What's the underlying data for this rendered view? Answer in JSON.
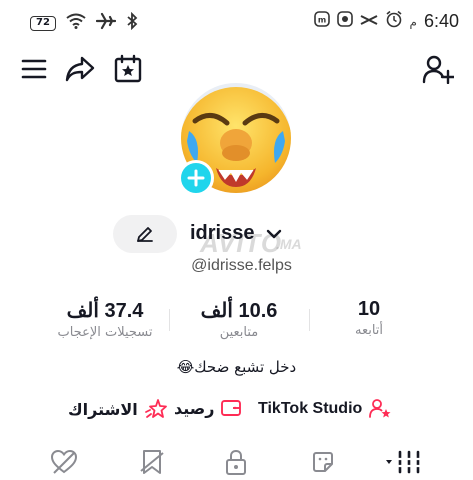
{
  "status": {
    "battery": "72",
    "time": "6:40",
    "ampm": "م"
  },
  "colors": {
    "accent": "#20d5ec",
    "pink": "#fe2c55",
    "text": "#161823",
    "muted": "#8a8b91"
  },
  "profile": {
    "username": "idrisse",
    "handle": "@idrisse.felps",
    "bio": "دخل تشبع ضحك😂",
    "watermark": "AVITO",
    "watermark_suffix": ".MA"
  },
  "stats": {
    "following": {
      "value": "10",
      "label": "أتابعه"
    },
    "followers": {
      "value": "10.6 ألف",
      "label": "متابعين"
    },
    "likes": {
      "value": "37.4 ألف",
      "label": "تسجيلات الإعجاب"
    }
  },
  "links": {
    "studio": "TikTok Studio",
    "balance": "رصيد",
    "subscription": "الاشتراك"
  },
  "icons": {
    "menu": "hamburger-icon",
    "share": "share-icon",
    "calendar": "calendar-star-icon",
    "add_friend": "add-user-icon"
  }
}
